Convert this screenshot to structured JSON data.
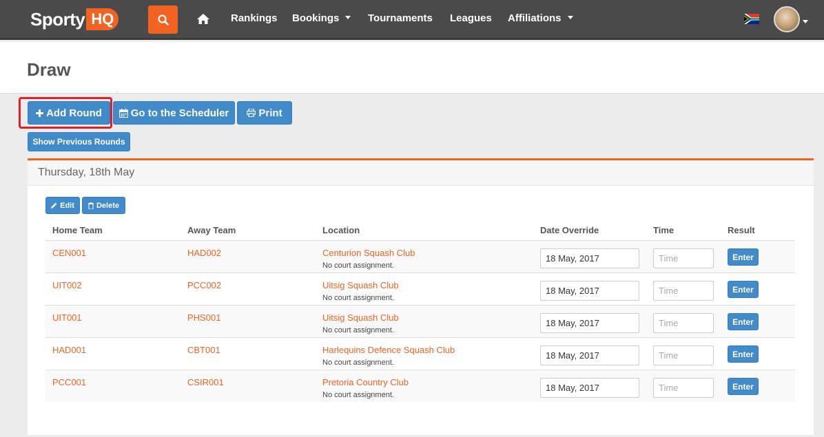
{
  "brand": {
    "name": "Sporty",
    "suffix": "HQ",
    "accent": "#f26322",
    "primary": "#428bca"
  },
  "nav": {
    "items": [
      {
        "label": "Rankings",
        "dropdown": false
      },
      {
        "label": "Bookings",
        "dropdown": true
      },
      {
        "label": "Tournaments",
        "dropdown": false
      },
      {
        "label": "Leagues",
        "dropdown": false
      },
      {
        "label": "Affiliations",
        "dropdown": true
      }
    ],
    "icons": [
      "search-icon",
      "home-icon",
      "south-africa-flag-icon",
      "user-avatar"
    ]
  },
  "page": {
    "title": "Draw"
  },
  "toolbar": {
    "add_round": "Add Round",
    "scheduler": "Go to the Scheduler",
    "print": "Print",
    "show_previous": "Show Previous Rounds"
  },
  "round": {
    "date": "Thursday, 18th May",
    "edit": "Edit",
    "delete": "Delete",
    "columns": {
      "home": "Home Team",
      "away": "Away Team",
      "location": "Location",
      "date_override": "Date Override",
      "time": "Time",
      "result": "Result"
    },
    "time_placeholder": "Time",
    "enter_label": "Enter",
    "matches": [
      {
        "home": "CEN001",
        "away": "HAD002",
        "location": "Centurion Squash Club",
        "court": "No court assignment.",
        "date": "18 May, 2017"
      },
      {
        "home": "UIT002",
        "away": "PCC002",
        "location": "Uitsig Squash Club",
        "court": "No court assignment.",
        "date": "18 May, 2017"
      },
      {
        "home": "UIT001",
        "away": "PHS001",
        "location": "Uitsig Squash Club",
        "court": "No court assignment.",
        "date": "18 May, 2017"
      },
      {
        "home": "HAD001",
        "away": "CBT001",
        "location": "Harlequins Defence Squash Club",
        "court": "No court assignment.",
        "date": "18 May, 2017"
      },
      {
        "home": "PCC001",
        "away": "CSIR001",
        "location": "Pretoria Country Club",
        "court": "No court assignment.",
        "date": "18 May, 2017"
      }
    ]
  }
}
